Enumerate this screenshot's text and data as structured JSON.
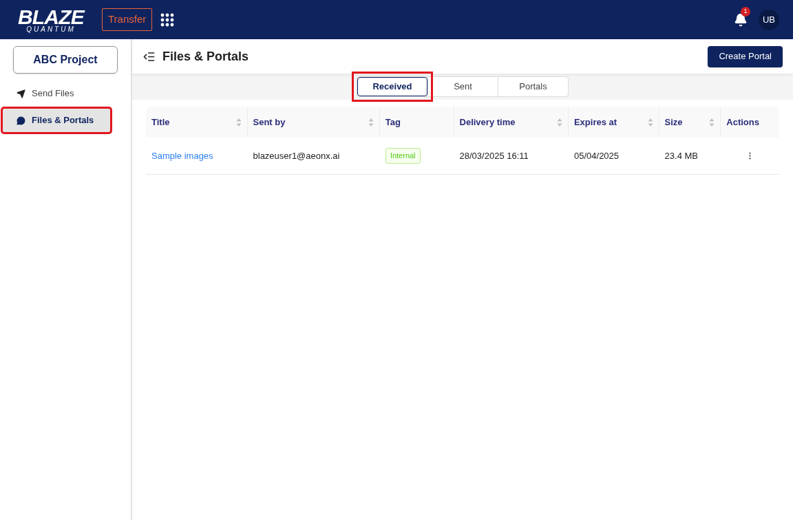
{
  "header": {
    "logo": {
      "line1": "BLAZE",
      "line2": "QUANTUM"
    },
    "app_button": "Transfer",
    "notification_count": "1",
    "avatar": "UB"
  },
  "sidebar": {
    "project": "ABC Project",
    "items": [
      {
        "label": "Send Files",
        "kind": "send",
        "selected": false,
        "highlighted": false
      },
      {
        "label": "Files & Portals",
        "kind": "chat",
        "selected": true,
        "highlighted": true
      }
    ]
  },
  "page": {
    "title": "Files & Portals",
    "create_button": "Create Portal"
  },
  "tabs": [
    {
      "label": "Received",
      "selected": true,
      "highlighted": true
    },
    {
      "label": "Sent",
      "selected": false,
      "highlighted": false
    },
    {
      "label": "Portals",
      "selected": false,
      "highlighted": false
    }
  ],
  "table": {
    "columns": [
      {
        "label": "Title",
        "sortable": true
      },
      {
        "label": "Sent by",
        "sortable": true
      },
      {
        "label": "Tag",
        "sortable": false
      },
      {
        "label": "Delivery time",
        "sortable": true
      },
      {
        "label": "Expires at",
        "sortable": true
      },
      {
        "label": "Size",
        "sortable": true
      },
      {
        "label": "Actions",
        "sortable": false
      }
    ],
    "rows": [
      {
        "title": "Sample images",
        "sent_by": "blazeuser1@aeonx.ai",
        "tag": "Internal",
        "delivery_time": "28/03/2025 16:11",
        "expires_at": "05/04/2025",
        "size": "23.4 MB"
      }
    ]
  }
}
